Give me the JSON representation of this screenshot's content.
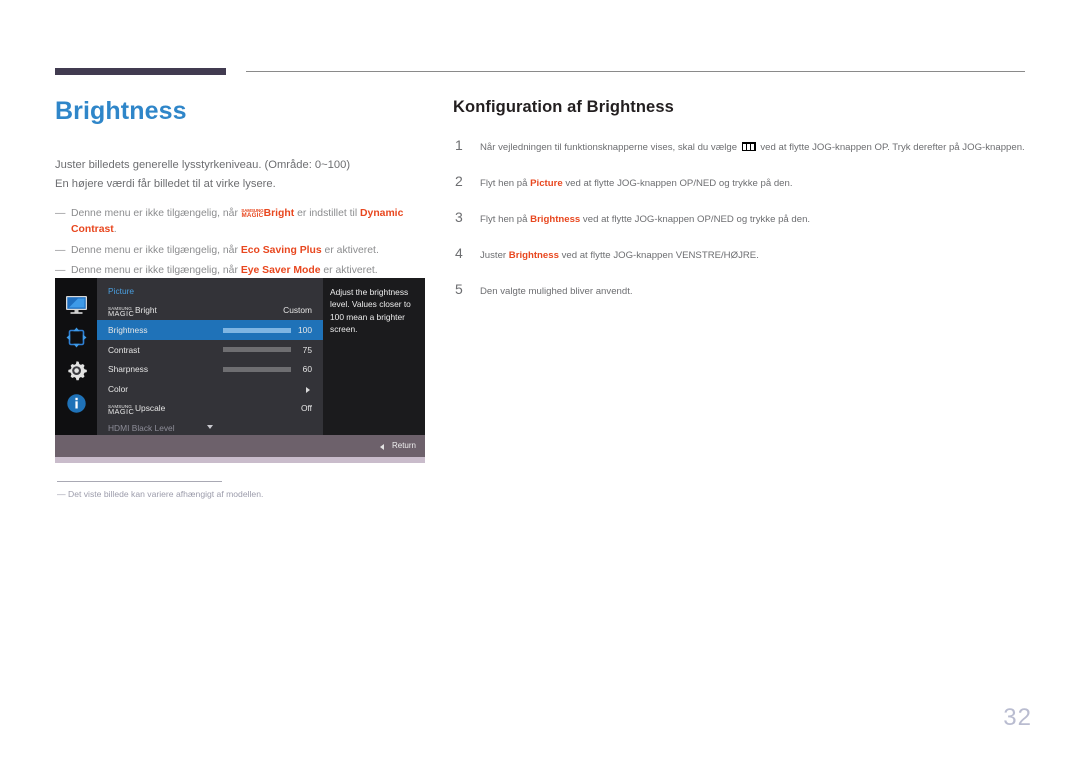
{
  "header": {
    "accent_color": "#413b50",
    "rule_color": "#8a8a8a"
  },
  "left": {
    "page_title": "Brightness",
    "title_color": "#2f86c9",
    "intro_lines": [
      "Juster billedets generelle lysstyrkeniveau. (Område: 0~100)",
      "En højere værdi får billedet til at virke lysere."
    ],
    "notes": [
      {
        "dash": "—",
        "prefix": "Denne menu er ikke tilgængelig, når ",
        "magic_top": "SAMSUNG",
        "magic_bottom": "MAGIC",
        "magic_suffix": "Bright",
        "middle": " er indstillet til ",
        "highlight": "Dynamic Contrast",
        "suffix": "."
      },
      {
        "dash": "—",
        "prefix": "Denne menu er ikke tilgængelig, når ",
        "highlight": "Eco Saving Plus",
        "suffix": " er aktiveret."
      },
      {
        "dash": "—",
        "prefix": "Denne menu er ikke tilgængelig, når ",
        "highlight": "Eye Saver Mode",
        "suffix": " er aktiveret."
      }
    ],
    "highlight_color": "#e8471f",
    "footnote": {
      "dash": "—",
      "text": "Det viste billede kan variere afhængigt af modellen."
    }
  },
  "osd": {
    "heading": "Picture",
    "heading_color": "#4a9fe0",
    "sidebar_icons": [
      {
        "name": "picture-icon",
        "label": "Picture"
      },
      {
        "name": "screen-adjust-icon",
        "label": "Screen"
      },
      {
        "name": "system-gear-icon",
        "label": "System"
      },
      {
        "name": "information-icon",
        "label": "Information"
      }
    ],
    "rows": [
      {
        "label_magic_top": "SAMSUNG",
        "label_magic_bottom": "MAGIC",
        "label": "Bright",
        "value": "Custom",
        "type": "value",
        "selected": false,
        "disabled": false
      },
      {
        "label": "Brightness",
        "value": "100",
        "type": "slider",
        "fill_percent": 100,
        "selected": true,
        "disabled": false
      },
      {
        "label": "Contrast",
        "value": "75",
        "type": "slider",
        "fill_percent": 75,
        "selected": false,
        "disabled": false
      },
      {
        "label": "Sharpness",
        "value": "60",
        "type": "slider",
        "fill_percent": 60,
        "selected": false,
        "disabled": false
      },
      {
        "label": "Color",
        "value": "",
        "type": "submenu",
        "selected": false,
        "disabled": false
      },
      {
        "label_magic_top": "SAMSUNG",
        "label_magic_bottom": "MAGIC",
        "label": "Upscale",
        "value": "Off",
        "type": "value",
        "selected": false,
        "disabled": false
      },
      {
        "label": "HDMI Black Level",
        "value": "",
        "type": "value",
        "selected": false,
        "disabled": true
      }
    ],
    "help_text": "Adjust the brightness level. Values closer to 100 mean a brighter screen.",
    "bottom_bar": {
      "return_label": "Return"
    },
    "selected_color": "#1f72b8"
  },
  "right": {
    "section_title": "Konfiguration af Brightness",
    "steps": [
      {
        "num": "1",
        "before_glyph": "Når vejledningen til funktionsknapperne vises, skal du vælge ",
        "glyph": "menu-glyph",
        "after_glyph": " ved at flytte JOG-knappen OP. Tryk derefter på JOG-knappen."
      },
      {
        "num": "2",
        "prefix": "Flyt hen på ",
        "highlight": "Picture",
        "suffix": " ved at flytte JOG-knappen OP/NED og trykke på den."
      },
      {
        "num": "3",
        "prefix": "Flyt hen på ",
        "highlight": "Brightness",
        "suffix": " ved at flytte JOG-knappen OP/NED og trykke på den."
      },
      {
        "num": "4",
        "prefix": "Juster ",
        "highlight": "Brightness",
        "suffix": " ved at flytte JOG-knappen VENSTRE/HØJRE."
      },
      {
        "num": "5",
        "prefix": "Den valgte mulighed bliver anvendt.",
        "highlight": "",
        "suffix": ""
      }
    ]
  },
  "page_number": "32"
}
